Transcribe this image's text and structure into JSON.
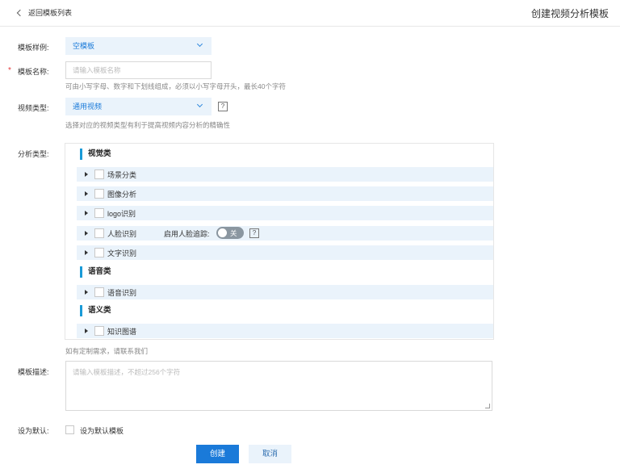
{
  "header": {
    "back_label": "返回模板列表",
    "title": "创建视频分析模板"
  },
  "form": {
    "template_sample": {
      "label": "模板样例:",
      "value": "空模板"
    },
    "template_name": {
      "label": "模板名称:",
      "required_mark": "*",
      "placeholder": "请输入模板名称",
      "hint": "可由小写字母、数字和下划线组成，必须以小写字母开头，最长40个字符"
    },
    "video_type": {
      "label": "视频类型:",
      "value": "通用视频",
      "help": "?",
      "hint": "选择对应的视频类型有利于提高视频内容分析的精确性"
    },
    "analysis_type": {
      "label": "分析类型:",
      "categories": [
        {
          "name": "视觉类",
          "items": [
            "场景分类",
            "图像分析",
            "logo识别",
            "人脸识别",
            "文字识别"
          ]
        },
        {
          "name": "语音类",
          "items": [
            "语音识别"
          ]
        },
        {
          "name": "语义类",
          "items": [
            "知识图谱"
          ]
        }
      ],
      "face_tracking": {
        "label": "启用人脸追踪:",
        "toggle_label": "关",
        "help": "?"
      },
      "contact_hint": "如有定制需求，请联系我们"
    },
    "description": {
      "label": "模板描述:",
      "placeholder": "请输入模板描述，不超过256个字符"
    },
    "set_default": {
      "label": "设为默认:",
      "checkbox_label": "设为默认模板"
    }
  },
  "actions": {
    "create": "创建",
    "cancel": "取消"
  }
}
